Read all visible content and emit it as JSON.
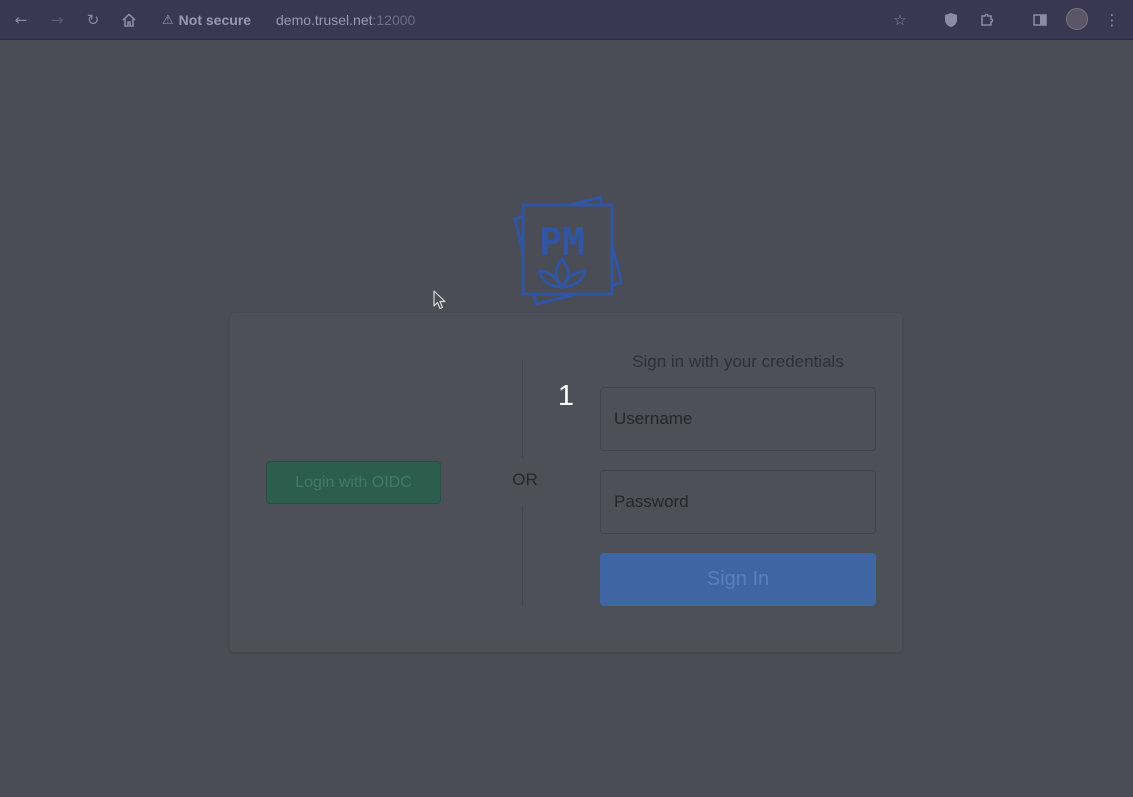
{
  "browser": {
    "nav": {
      "back_icon": "arrow-left-icon",
      "forward_icon": "arrow-right-icon",
      "reload_icon": "reload-icon",
      "home_icon": "home-icon"
    },
    "security_label": "Not secure",
    "url_host": "demo.trusel.net",
    "url_port": ":12000",
    "icons": [
      "star-icon",
      "shield-extension-icon",
      "puzzle-icon",
      "sidepanel-icon",
      "avatar",
      "kebab-menu-icon"
    ]
  },
  "logo": {
    "text": "PM",
    "color": "#2f55a4"
  },
  "login": {
    "oidc_button_label": "Login with OIDC",
    "or_label": "OR",
    "step_number": "1",
    "heading": "Sign in with your credentials",
    "username_placeholder": "Username",
    "password_placeholder": "Password",
    "signin_button_label": "Sign In"
  },
  "colors": {
    "overlay_background": "#4a4d55",
    "oidc_button": "#2d5d4c",
    "signin_button": "#4065a3",
    "toolbar": "#3a3752"
  }
}
